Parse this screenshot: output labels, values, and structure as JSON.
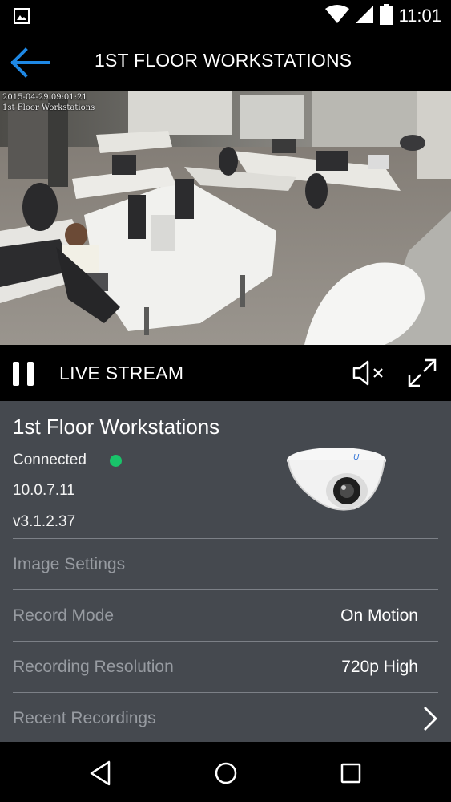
{
  "status_bar": {
    "time": "11:01",
    "icons": [
      "image-notification-icon",
      "wifi-icon",
      "cell-signal-icon",
      "battery-icon"
    ]
  },
  "header": {
    "title": "1ST FLOOR WORKSTATIONS",
    "back_icon": "back-arrow-icon",
    "accent_color": "#1e88e5"
  },
  "video": {
    "timestamp": "2015-04-29 09:01:21",
    "overlay_name": "1st Floor Workstations"
  },
  "controls": {
    "pause_icon": "pause-icon",
    "mode_label": "LIVE STREAM",
    "mute_icon": "volume-muted-icon",
    "fullscreen_icon": "fullscreen-icon"
  },
  "camera": {
    "name": "1st Floor Workstations",
    "status": "Connected",
    "status_color": "#19c46a",
    "ip": "10.0.7.11",
    "firmware": "v3.1.2.37"
  },
  "settings": [
    {
      "label": "Image Settings",
      "value": ""
    },
    {
      "label": "Record Mode",
      "value": "On Motion"
    },
    {
      "label": "Recording Resolution",
      "value": "720p High"
    },
    {
      "label": "Recent Recordings",
      "value": "",
      "icon": "chevron-right-icon"
    }
  ],
  "nav": {
    "buttons": [
      "back-triangle-icon",
      "home-circle-icon",
      "recents-square-icon"
    ]
  }
}
